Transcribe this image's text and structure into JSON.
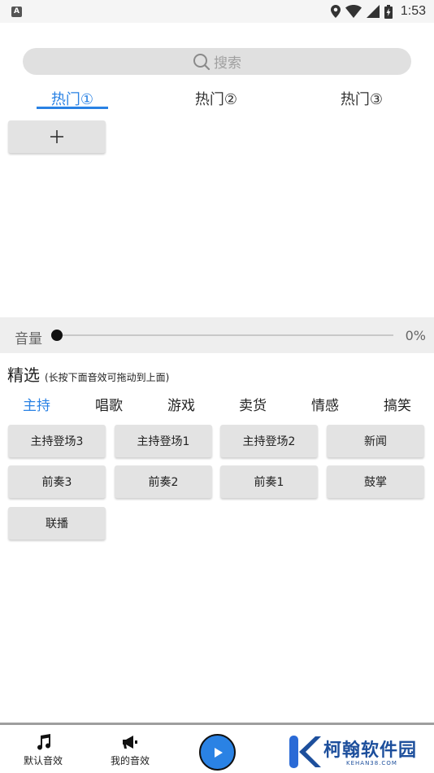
{
  "status_bar": {
    "time": "1:53",
    "app_icon_letter": "A"
  },
  "search": {
    "placeholder": "搜索"
  },
  "hot_tabs": [
    {
      "label": "热门①",
      "active": true
    },
    {
      "label": "热门②",
      "active": false
    },
    {
      "label": "热门③",
      "active": false
    }
  ],
  "add_button_label": "+",
  "volume": {
    "label": "音量",
    "value_text": "0%",
    "level": 0
  },
  "featured": {
    "title": "精选",
    "hint": "(长按下面音效可拖动到上面)"
  },
  "categories": [
    {
      "label": "主持",
      "active": true
    },
    {
      "label": "唱歌",
      "active": false
    },
    {
      "label": "游戏",
      "active": false
    },
    {
      "label": "卖货",
      "active": false
    },
    {
      "label": "情感",
      "active": false
    },
    {
      "label": "搞笑",
      "active": false
    }
  ],
  "sounds": [
    "主持登场3",
    "主持登场1",
    "主持登场2",
    "新闻",
    "前奏3",
    "前奏2",
    "前奏1",
    "鼓掌",
    "联播"
  ],
  "bottom_nav": {
    "default_sounds": "默认音效",
    "my_sounds": "我的音效"
  },
  "watermark": {
    "name": "柯翰软件园",
    "domain": "KEHAN38.COM"
  },
  "colors": {
    "accent": "#2a82e4",
    "button_bg": "#e3e3e3",
    "brand": "#1d4f9c"
  }
}
